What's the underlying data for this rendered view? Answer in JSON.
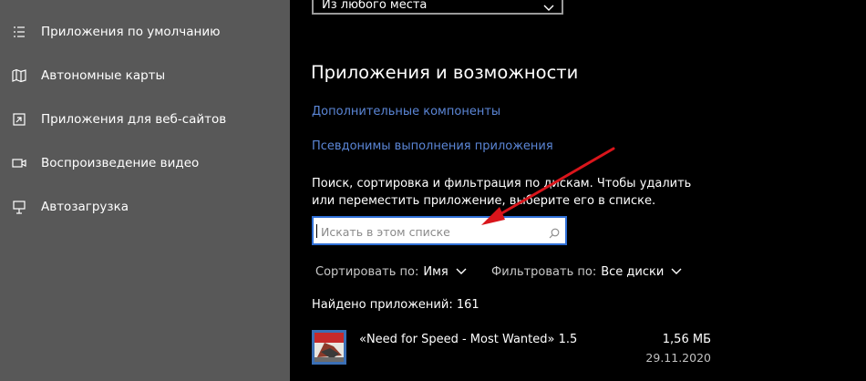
{
  "sidebar": {
    "items": [
      {
        "label": "Приложения по умолчанию",
        "icon": "default-apps-icon"
      },
      {
        "label": "Автономные карты",
        "icon": "offline-maps-icon"
      },
      {
        "label": "Приложения для веб-сайтов",
        "icon": "apps-for-websites-icon"
      },
      {
        "label": "Воспроизведение видео",
        "icon": "video-playback-icon"
      },
      {
        "label": "Автозагрузка",
        "icon": "startup-icon"
      }
    ]
  },
  "main": {
    "install_source_value": "Из любого места",
    "section_title": "Приложения и возможности",
    "optional_features_link": "Дополнительные компоненты",
    "app_aliases_link": "Псевдонимы выполнения приложения",
    "description": "Поиск, сортировка и фильтрация по дискам. Чтобы удалить или переместить приложение, выберите его в списке.",
    "search_placeholder": "Искать в этом списке",
    "sort_label": "Сортировать по:",
    "sort_value": "Имя",
    "filter_label": "Фильтровать по:",
    "filter_value": "Все диски",
    "found_text": "Найдено приложений: 161",
    "apps": [
      {
        "name": "«Need for Speed - Most Wanted»  1.5",
        "size": "1,56 МБ",
        "date": "29.11.2020"
      }
    ]
  },
  "colors": {
    "sidebar_bg": "#585858",
    "main_bg": "#000000",
    "link": "#5b86d6",
    "search_border": "#2f6fd6",
    "annotation_arrow": "#d9151b"
  }
}
